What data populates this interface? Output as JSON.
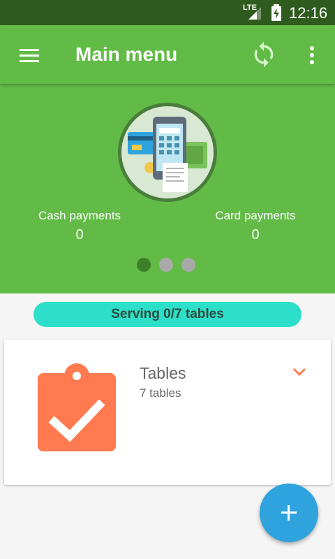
{
  "status_bar": {
    "network_type": "LTE",
    "time": "12:16",
    "icons": [
      "signal-icon",
      "battery-charging-icon"
    ]
  },
  "app_bar": {
    "title": "Main menu",
    "icons": [
      "menu-icon",
      "sync-icon",
      "more-vert-icon"
    ]
  },
  "summary": {
    "illustration": "payment-terminal-illustration",
    "cash_label": "Cash payments",
    "cash_value": "0",
    "card_label": "Card payments",
    "card_value": "0",
    "pager_total": 3,
    "pager_active": 1
  },
  "serving": {
    "label": "Serving 0/7 tables"
  },
  "tables_card": {
    "title": "Tables",
    "subtitle": "7 tables",
    "icon": "clipboard-check-icon",
    "expand_icon": "chevron-down-icon"
  },
  "fab": {
    "icon": "add-icon"
  },
  "colors": {
    "status_bar": "#2f5c1e",
    "primary_green": "#61bb46",
    "pager_active": "#3e7f2a",
    "pager_inactive": "#a9a9a9",
    "serving_pill": "#2ddfc8",
    "card_icon": "#ff7a50",
    "fab": "#2ea3dd"
  }
}
